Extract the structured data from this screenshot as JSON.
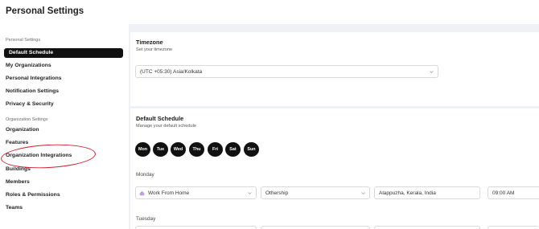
{
  "header": {
    "title": "Personal Settings"
  },
  "sidebar": {
    "personal_section": "Personal Settings",
    "personal_items": [
      {
        "label": "Default Schedule"
      },
      {
        "label": "My Organizations"
      },
      {
        "label": "Personal Integrations"
      },
      {
        "label": "Notification Settings"
      },
      {
        "label": "Privacy & Security"
      }
    ],
    "org_section": "Organization Settings",
    "org_items": [
      {
        "label": "Organization"
      },
      {
        "label": "Features"
      },
      {
        "label": "Organization Integrations"
      },
      {
        "label": "Buildings"
      },
      {
        "label": "Members"
      },
      {
        "label": "Roles & Permissions"
      },
      {
        "label": "Teams"
      }
    ],
    "highlight_color": "#d11f2b"
  },
  "timezone": {
    "title": "Timezone",
    "subtitle": "Set your timezone",
    "value": "(UTC +05:30) Asia/Kolkata"
  },
  "schedule": {
    "title": "Default Schedule",
    "subtitle": "Manage your default schedule",
    "days": [
      "Mon",
      "Tue",
      "Wed",
      "Thu",
      "Fri",
      "Sat",
      "Sun"
    ],
    "monday": {
      "label": "Monday",
      "work_type": "Work From Home",
      "organization": "Othership",
      "location": "Alappuzha, Kerala, India",
      "time": "09:00 AM"
    },
    "tuesday": {
      "label": "Tuesday"
    }
  },
  "icons": {
    "home": "home-icon",
    "dropdown": "chevron-down-icon"
  }
}
